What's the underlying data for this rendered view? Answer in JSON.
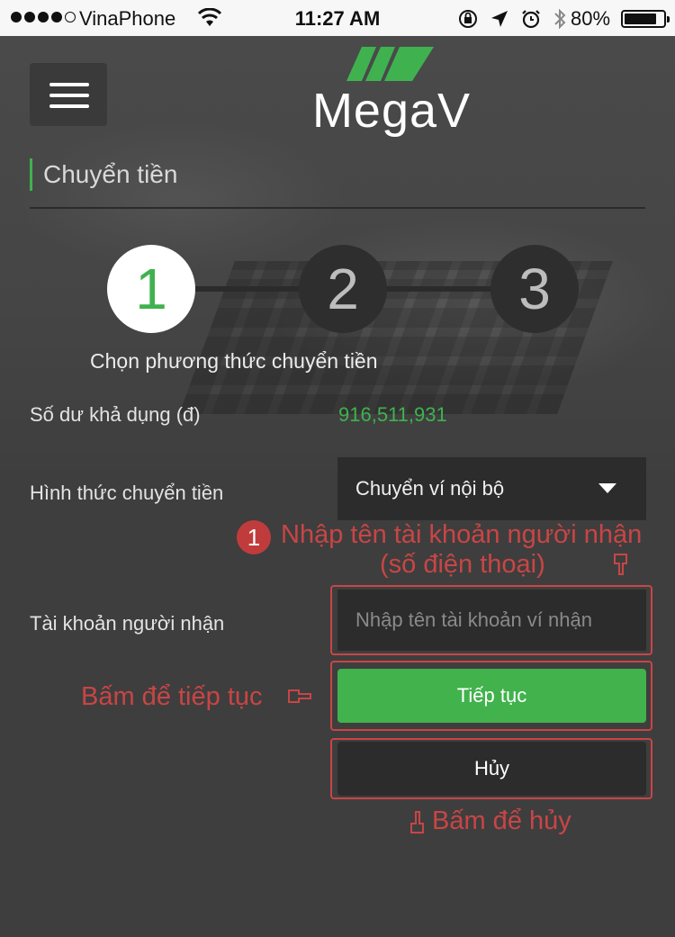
{
  "status_bar": {
    "carrier": "VinaPhone",
    "time": "11:27 AM",
    "battery_percent": "80%",
    "battery_level": 0.8,
    "icons": [
      "wifi-icon",
      "orientation-lock-icon",
      "location-arrow-icon",
      "alarm-icon",
      "bluetooth-icon"
    ]
  },
  "header": {
    "menu_icon": "hamburger-menu-icon",
    "logo_text": "MegaV",
    "brand_color": "#3fb24f"
  },
  "page": {
    "title": "Chuyển tiền"
  },
  "steps": {
    "items": [
      "1",
      "2",
      "3"
    ],
    "active_index": 0,
    "active_label": "Chọn phương thức chuyển tiền"
  },
  "form": {
    "balance_label": "Số dư khả dụng (đ)",
    "balance_value": "916,511,931",
    "method_label": "Hình thức chuyển tiền",
    "method_value": "Chuyển ví nội bộ",
    "recipient_label": "Tài khoản người nhận",
    "recipient_placeholder": "Nhập tên tài khoản ví nhận",
    "continue_label": "Tiếp tục",
    "cancel_label": "Hủy"
  },
  "annotations": {
    "badge": "1",
    "recipient_hint_line1": "Nhập tên tài khoản người nhận",
    "recipient_hint_line2": "(số điện thoại)",
    "continue_hint": "Bấm để tiếp tục",
    "cancel_hint": "Bấm để hủy",
    "hint_color": "#c94545"
  }
}
